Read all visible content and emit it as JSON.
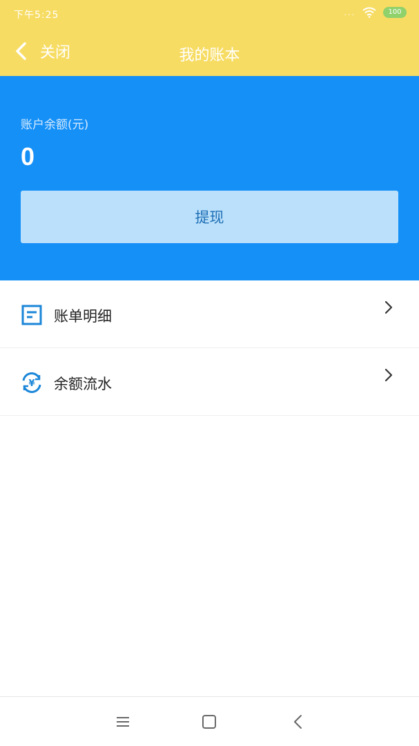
{
  "status_bar": {
    "time": "下午5:25",
    "signal_text": "...",
    "battery": "100"
  },
  "header": {
    "back_label": "关闭",
    "title": "我的账本"
  },
  "balance": {
    "label": "账户余额(元)",
    "value": "0",
    "withdraw_label": "提现"
  },
  "menu": {
    "items": [
      {
        "label": "账单明细",
        "icon": "bill-detail-icon"
      },
      {
        "label": "余额流水",
        "icon": "balance-flow-icon"
      }
    ]
  },
  "nav": {
    "icons": [
      "menu-icon",
      "home-square-icon",
      "back-arrow-icon"
    ]
  },
  "colors": {
    "header_yellow": "#f7dc63",
    "balance_blue": "#1590f7",
    "button_light_blue": "#bbe0fb",
    "icon_blue": "#1b86d8"
  }
}
